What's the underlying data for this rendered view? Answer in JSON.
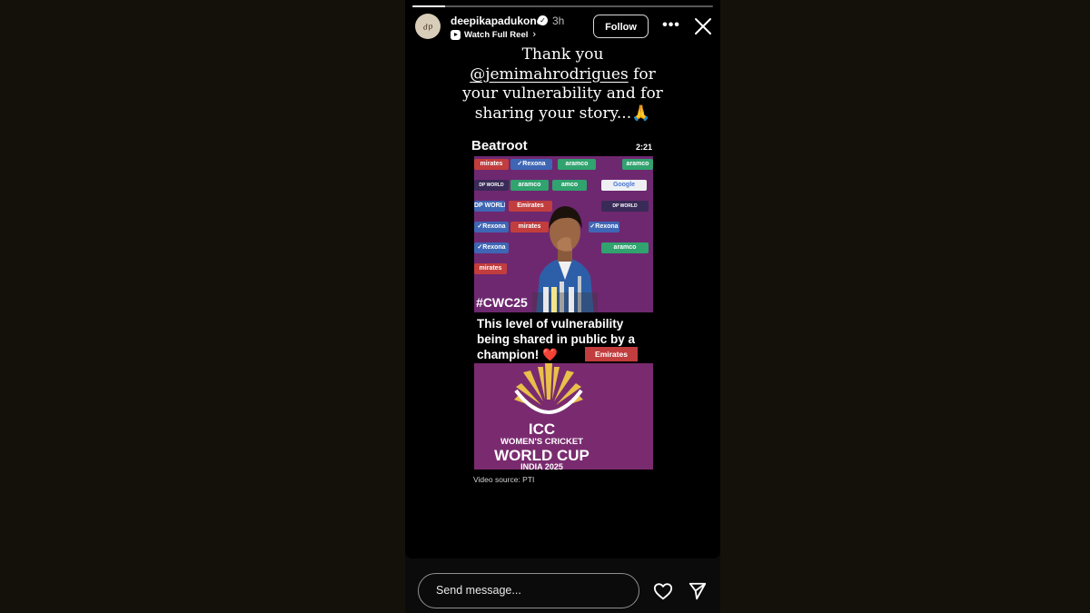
{
  "story": {
    "progress": 0.11,
    "username": "deepikapadukone",
    "time_ago": "3h",
    "watch_full_reel": "Watch Full Reel",
    "follow_label": "Follow",
    "more_label": "•••",
    "caption_line1": "Thank you",
    "mention": "@jemimahrodrigues",
    "caption_after_mention": " for",
    "caption_line3": "your vulnerability and for",
    "caption_line4": "sharing your story...🙏"
  },
  "embed": {
    "source_name": "Beatroot",
    "duration": "2:21",
    "hashtag": "#CWC25",
    "overlay_text": "This level of vulnerability being shared in public by a champion!",
    "overlay_emoji": "❤️",
    "banner_emirates": "Emirates",
    "icc_line1": "ICC",
    "icc_line2": "WOMEN'S CRICKET",
    "icc_line3": "WORLD CUP",
    "icc_line4": "INDIA 2025",
    "video_source": "Video source: PTI",
    "sponsor_tiles": [
      {
        "text": "mirates",
        "style": "t-red"
      },
      {
        "text": "✓Rexona",
        "style": "t-blue"
      },
      {
        "text": "aramco",
        "style": "t-green"
      },
      {
        "text": "aramco",
        "style": "t-green"
      },
      {
        "text": "DP WORLD",
        "style": "t-dark"
      },
      {
        "text": "aramco",
        "style": "t-green"
      },
      {
        "text": "amco",
        "style": "t-green"
      },
      {
        "text": "Google",
        "style": "t-google"
      },
      {
        "text": "DP WORLD",
        "style": "t-blue"
      },
      {
        "text": "Emirates",
        "style": "t-red"
      },
      {
        "text": "DP WORLD",
        "style": "t-dark"
      },
      {
        "text": "✓Rexona",
        "style": "t-blue"
      },
      {
        "text": "mirates",
        "style": "t-red"
      },
      {
        "text": "✓Rexona",
        "style": "t-blue"
      },
      {
        "text": "✓Rexona",
        "style": "t-blue"
      },
      {
        "text": "aramco",
        "style": "t-green"
      },
      {
        "text": "mirates",
        "style": "t-red"
      }
    ]
  },
  "footer": {
    "message_placeholder": "Send message..."
  },
  "icons": [
    "verified-badge-icon",
    "reel-icon",
    "chevron-right-icon",
    "more-icon",
    "close-icon",
    "heart-icon",
    "send-icon"
  ],
  "colors": {
    "page_bg": "#14110b",
    "story_bg": "#000000",
    "video_bg": "#6e2870",
    "accent_gold": "#e8c04a"
  }
}
